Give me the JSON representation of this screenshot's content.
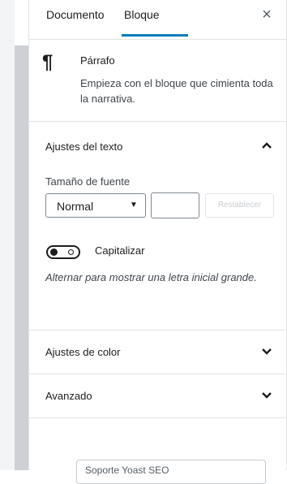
{
  "tabs": {
    "document": "Documento",
    "block": "Bloque",
    "close": "×"
  },
  "block_card": {
    "icon": "¶",
    "title": "Párrafo",
    "description": "Empieza con el bloque que cimienta toda la narrativa."
  },
  "text_settings": {
    "title": "Ajustes del texto",
    "font_size_label": "Tamaño de fuente",
    "font_size_value": "Normal",
    "custom_size_value": "",
    "reset_label": "Restablecer",
    "dropcap_label": "Capitalizar",
    "dropcap_enabled": false,
    "help": "Alternar para mostrar una letra inicial grande."
  },
  "color_settings": {
    "title": "Ajustes de color"
  },
  "advanced": {
    "title": "Avanzado"
  },
  "bottom_button": {
    "label": "Soporte Yoast SEO"
  },
  "colors": {
    "accent": "#007cba",
    "text": "#1e1e1e",
    "border": "#e2e4e7",
    "scrollbar": "#cdd0d4"
  },
  "icons": {
    "close": "close-icon",
    "paragraph": "paragraph-icon",
    "chevron_up": "chevron-up-icon",
    "chevron_down": "chevron-down-icon",
    "select_arrow": "select-arrow-icon"
  }
}
